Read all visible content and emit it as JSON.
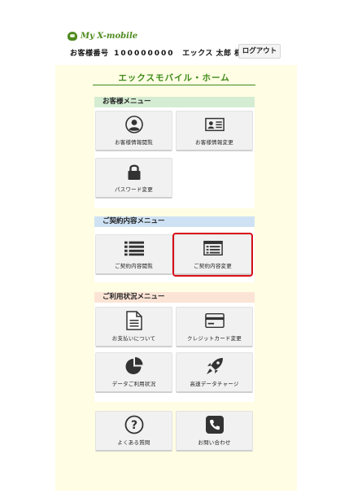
{
  "brand": {
    "logo_text": "My X-mobile",
    "logo_color": "#4f8a1f"
  },
  "header": {
    "customer_number_label": "お客様番号",
    "customer_number": "100000000",
    "customer_name": "エックス 太郎 様",
    "logout_label": "ログアウト"
  },
  "page": {
    "title": "エックスモバイル・ホーム",
    "accent_color": "#3d8a1a"
  },
  "sections": {
    "customer": {
      "header": "お客様メニュー",
      "items": [
        {
          "label": "お客様情報閲覧",
          "icon": "person-icon"
        },
        {
          "label": "お客様情報変更",
          "icon": "id-card-icon"
        },
        {
          "label": "パスワード変更",
          "icon": "lock-icon"
        }
      ]
    },
    "contract": {
      "header": "ご契約内容メニュー",
      "items": [
        {
          "label": "ご契約内容閲覧",
          "icon": "list-icon"
        },
        {
          "label": "ご契約内容変更",
          "icon": "list-window-icon"
        }
      ]
    },
    "usage": {
      "header": "ご利用状況メニュー",
      "items": [
        {
          "label": "お支払いについて",
          "icon": "document-icon"
        },
        {
          "label": "クレジットカード変更",
          "icon": "credit-card-icon"
        },
        {
          "label": "データご利用状況",
          "icon": "pie-chart-icon"
        },
        {
          "label": "高速データチャージ",
          "icon": "rocket-icon"
        }
      ]
    },
    "support": {
      "items": [
        {
          "label": "よくある質問",
          "icon": "question-icon"
        },
        {
          "label": "お問い合わせ",
          "icon": "phone-icon"
        }
      ]
    }
  }
}
